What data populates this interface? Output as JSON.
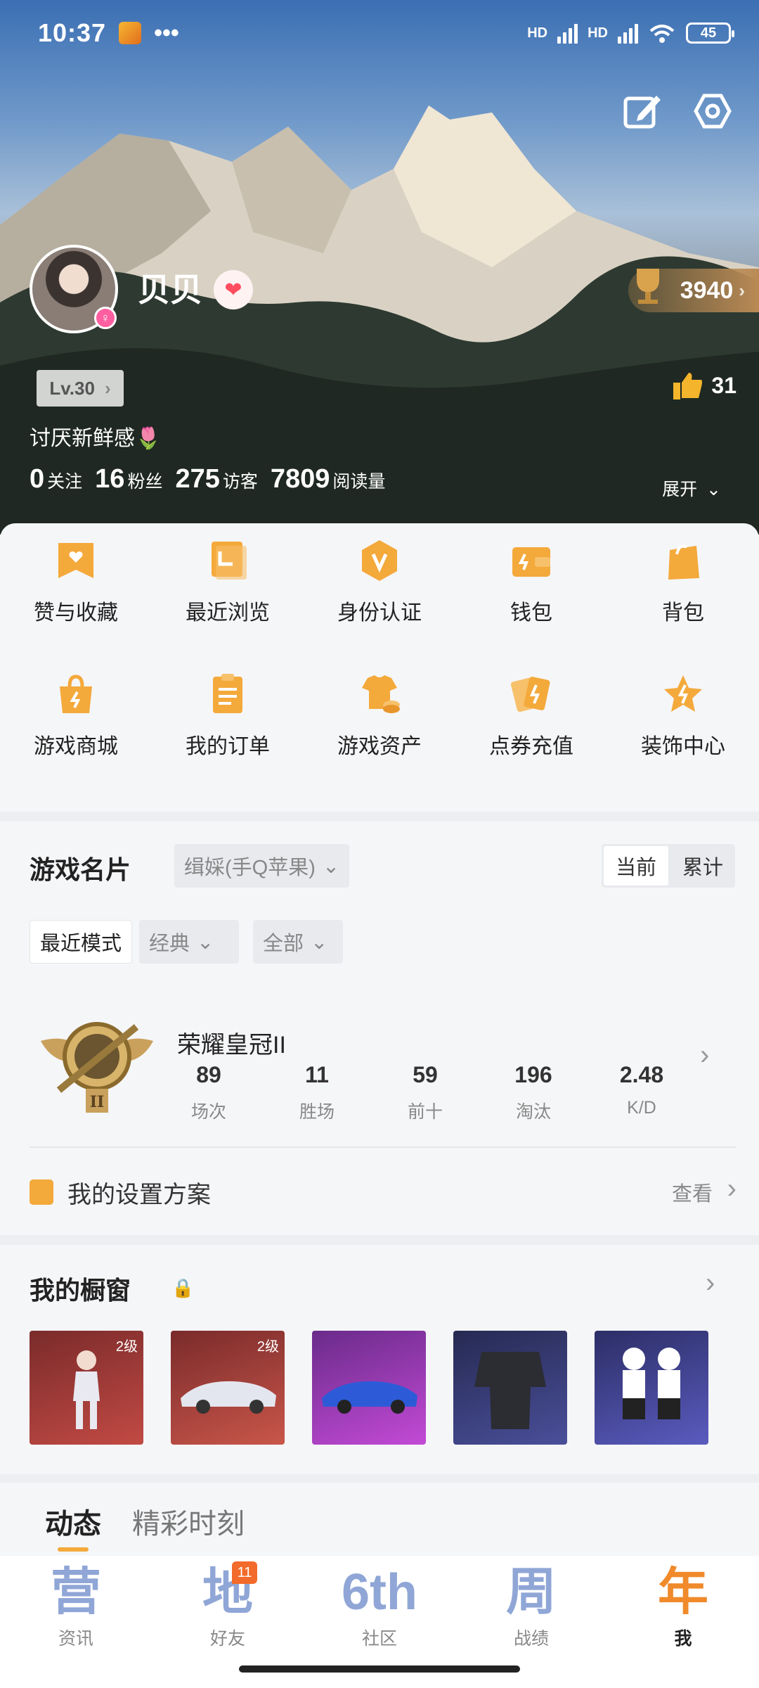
{
  "status_bar": {
    "time": "10:37",
    "dots": "•••",
    "battery": "45",
    "network_1": "HD",
    "network_2": "HD"
  },
  "profile": {
    "nickname": "贝贝",
    "trophy_score": "3940",
    "level": "Lv.30",
    "likes": "31",
    "bio": "讨厌新鲜感🌷",
    "stats": [
      {
        "value": "0",
        "label": "关注"
      },
      {
        "value": "16",
        "label": "粉丝"
      },
      {
        "value": "275",
        "label": "访客"
      },
      {
        "value": "7809",
        "label": "阅读量"
      }
    ],
    "expand_label": "展开"
  },
  "menu": [
    {
      "label": "赞与收藏",
      "icon": "bookmark-heart-icon"
    },
    {
      "label": "最近浏览",
      "icon": "recent-icon"
    },
    {
      "label": "身份认证",
      "icon": "verify-icon"
    },
    {
      "label": "钱包",
      "icon": "wallet-icon"
    },
    {
      "label": "背包",
      "icon": "bag-icon"
    },
    {
      "label": "游戏商城",
      "icon": "shop-icon"
    },
    {
      "label": "我的订单",
      "icon": "order-icon"
    },
    {
      "label": "游戏资产",
      "icon": "assets-icon"
    },
    {
      "label": "点券充值",
      "icon": "recharge-icon"
    },
    {
      "label": "装饰中心",
      "icon": "decor-icon"
    }
  ],
  "game_card": {
    "title": "游戏名片",
    "account": "缉婇(手Q苹果)",
    "toggle": [
      "当前",
      "累计"
    ],
    "mode": "最近模式",
    "type": "经典",
    "range": "全部",
    "rank_name": "荣耀皇冠II",
    "rank_stats": [
      {
        "value": "89",
        "label": "场次"
      },
      {
        "value": "11",
        "label": "胜场"
      },
      {
        "value": "59",
        "label": "前十"
      },
      {
        "value": "196",
        "label": "淘汰"
      },
      {
        "value": "2.48",
        "label": "K/D"
      }
    ],
    "plan_title": "我的设置方案",
    "plan_view": "查看"
  },
  "showcase": {
    "title": "我的橱窗",
    "items": [
      {
        "tag": "2级",
        "color": "#b63a3a"
      },
      {
        "tag": "2级",
        "color": "#c0473f"
      },
      {
        "tag": "",
        "color": "#a43ab6"
      },
      {
        "tag": "",
        "color": "#3c3f7a"
      },
      {
        "tag": "",
        "color": "#4b4a8e"
      }
    ]
  },
  "feed_tabs": [
    "动态",
    "精彩时刻"
  ],
  "bottom_nav": [
    {
      "glyph": "营",
      "label": "资讯"
    },
    {
      "glyph": "地",
      "label": "好友",
      "badge": "11"
    },
    {
      "glyph": "6th",
      "label": "社区"
    },
    {
      "glyph": "周",
      "label": "战绩"
    },
    {
      "glyph": "年",
      "label": "我"
    }
  ],
  "colors": {
    "accent": "#f4a93b",
    "nav_inactive": "#8fa6d6",
    "nav_active": "#f08a2b"
  }
}
